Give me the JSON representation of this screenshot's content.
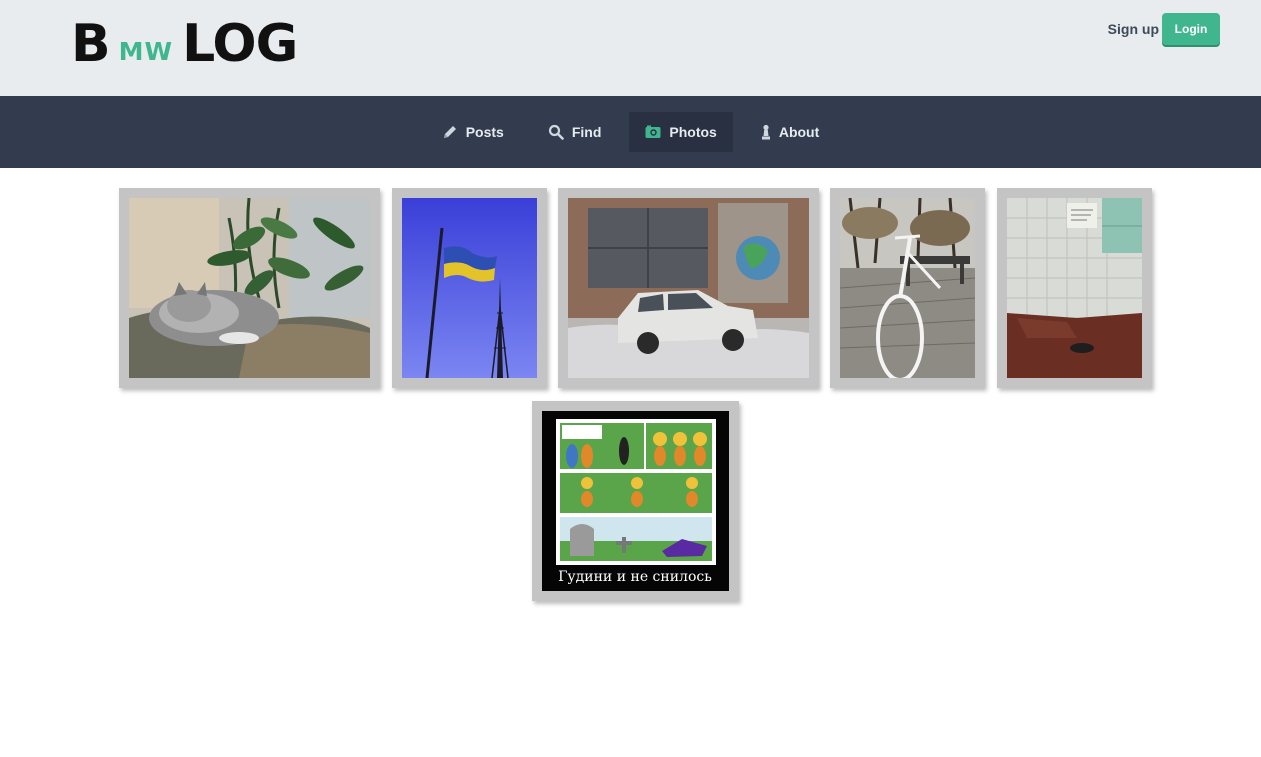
{
  "brand": {
    "b": "B",
    "mw": "MW",
    "log": "LOG"
  },
  "auth": {
    "signup_label": "Sign up",
    "login_label": "Login"
  },
  "nav": {
    "items": [
      {
        "label": "Posts",
        "icon": "pencil-icon"
      },
      {
        "label": "Find",
        "icon": "search-icon"
      },
      {
        "label": "Photos",
        "icon": "camera-icon",
        "active": true
      },
      {
        "label": "About",
        "icon": "chess-pawn-icon"
      }
    ]
  },
  "photos": [
    {
      "subject": "cat sleeping on a sofa near house plants"
    },
    {
      "subject": "flag on a pole with a radio tower"
    },
    {
      "subject": "old white car in front of a brick wall"
    },
    {
      "subject": "white bicycle in a park"
    },
    {
      "subject": "tiled hallway with a note and a box"
    },
    {
      "subject": "comic",
      "caption": "Гудини и не снилось"
    }
  ],
  "colors": {
    "accent": "#3fb68e",
    "nav_bg": "#323c4e",
    "header_bg": "#e9ecef"
  }
}
